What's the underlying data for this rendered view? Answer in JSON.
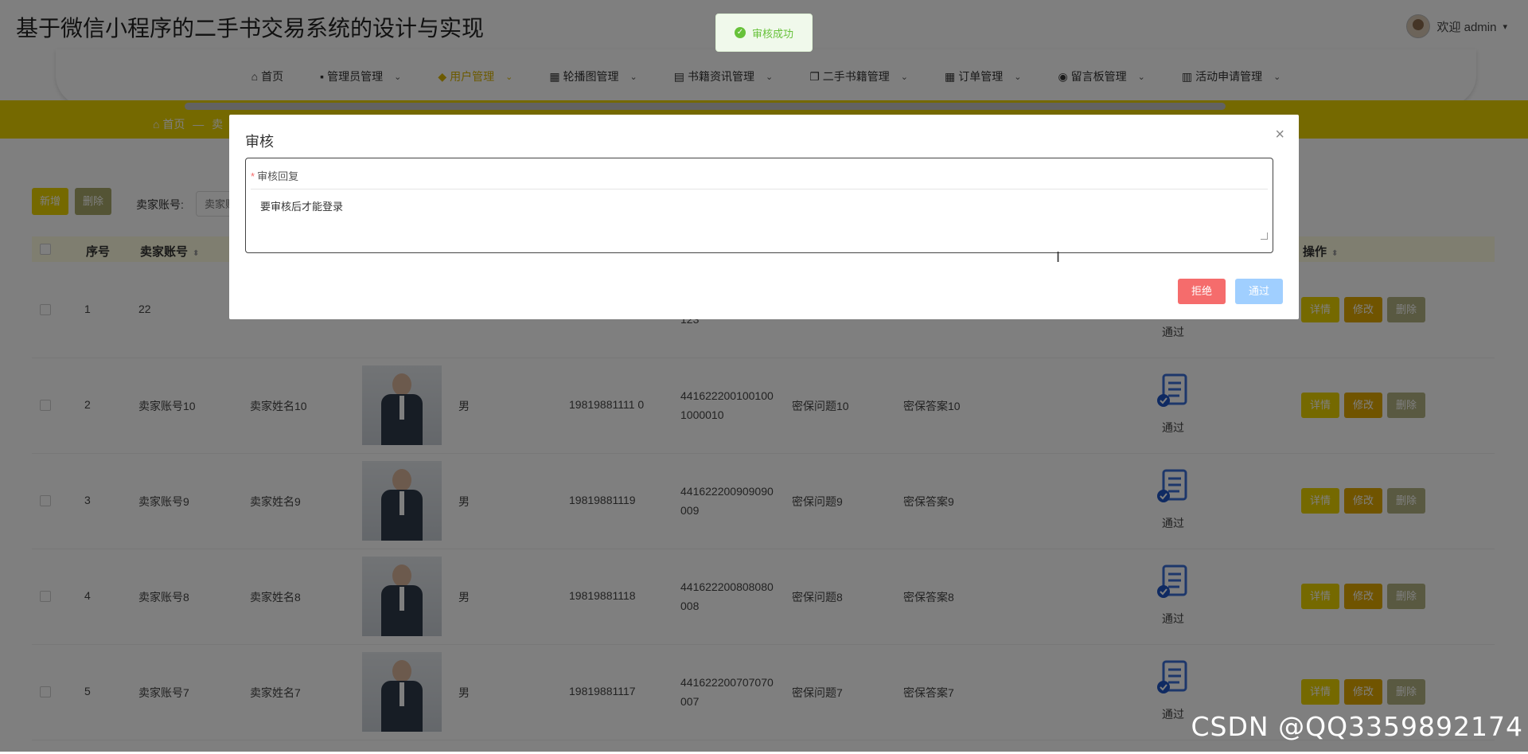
{
  "header": {
    "app_title": "基于微信小程序的二手书交易系统的设计与实现",
    "welcome": "欢迎 admin",
    "user_dropdown_icon": "chevron-down-icon"
  },
  "nav": {
    "items": [
      {
        "label": "首页",
        "icon": "home-icon",
        "has_dropdown": false
      },
      {
        "label": "管理员管理",
        "icon": "user-icon",
        "has_dropdown": true
      },
      {
        "label": "用户管理",
        "icon": "users-icon",
        "has_dropdown": true
      },
      {
        "label": "轮播图管理",
        "icon": "grid-icon",
        "has_dropdown": true
      },
      {
        "label": "书籍资讯管理",
        "icon": "card-icon",
        "has_dropdown": true
      },
      {
        "label": "二手书籍管理",
        "icon": "copy-icon",
        "has_dropdown": true
      },
      {
        "label": "订单管理",
        "icon": "grid-icon",
        "has_dropdown": true
      },
      {
        "label": "留言板管理",
        "icon": "compass-icon",
        "has_dropdown": true
      },
      {
        "label": "活动申请管理",
        "icon": "layout-icon",
        "has_dropdown": true
      }
    ],
    "active_index": 2
  },
  "breadcrumb": {
    "home": "首页",
    "separator": "—",
    "current": "卖"
  },
  "toolbar": {
    "add_label": "新增",
    "delete_label": "删除",
    "search_label": "卖家账号:",
    "search_placeholder": "卖家账号"
  },
  "table": {
    "headers": [
      "序号",
      "卖家账号",
      "操作"
    ],
    "rows": [
      {
        "index": "1",
        "account": "22",
        "name": "",
        "gender": "",
        "phone": "",
        "id_line1": "",
        "id_line2": "123",
        "question": "",
        "answer": "",
        "status": "通过"
      },
      {
        "index": "2",
        "account": "卖家账号10",
        "name": "卖家姓名10",
        "gender": "男",
        "phone": "19819881111 0",
        "id_line1": "441622200100100",
        "id_line2": "1000010",
        "question": "密保问题10",
        "answer": "密保答案10",
        "status": "通过"
      },
      {
        "index": "3",
        "account": "卖家账号9",
        "name": "卖家姓名9",
        "gender": "男",
        "phone": "19819881119",
        "id_line1": "441622200909090",
        "id_line2": "009",
        "question": "密保问题9",
        "answer": "密保答案9",
        "status": "通过"
      },
      {
        "index": "4",
        "account": "卖家账号8",
        "name": "卖家姓名8",
        "gender": "男",
        "phone": "19819881118",
        "id_line1": "441622200808080",
        "id_line2": "008",
        "question": "密保问题8",
        "answer": "密保答案8",
        "status": "通过"
      },
      {
        "index": "5",
        "account": "卖家账号7",
        "name": "卖家姓名7",
        "gender": "男",
        "phone": "19819881117",
        "id_line1": "441622200707070",
        "id_line2": "007",
        "question": "密保问题7",
        "answer": "密保答案7",
        "status": "通过"
      }
    ],
    "actions": {
      "detail": "详情",
      "edit": "修改",
      "delete": "删除"
    }
  },
  "modal": {
    "title": "审核",
    "field_label": "审核回复",
    "field_value": "要审核后才能登录",
    "reject_label": "拒绝",
    "pass_label": "通过"
  },
  "toast": {
    "message": "审核成功"
  },
  "watermark": "CSDN @QQ3359892174",
  "colors": {
    "brand": "#ead300",
    "danger": "#f56c6c",
    "primary_light": "#a0cfff",
    "success": "#67c23a"
  }
}
